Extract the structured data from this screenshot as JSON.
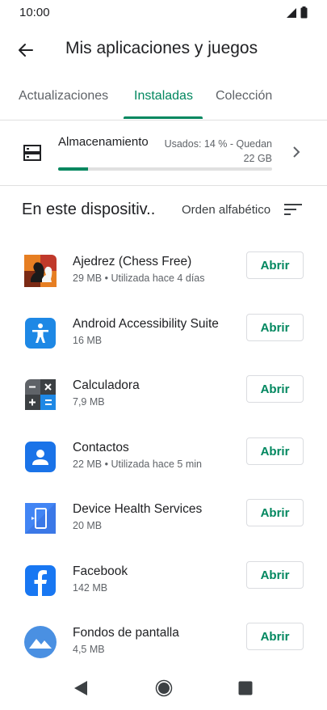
{
  "status_bar": {
    "time": "10:00"
  },
  "header": {
    "title": "Mis aplicaciones y juegos"
  },
  "tabs": [
    {
      "label": "Actualizaciones"
    },
    {
      "label": "Instaladas",
      "active": true
    },
    {
      "label": "Colección"
    }
  ],
  "storage": {
    "title": "Almacenamiento",
    "used_line1": "Usados: 14 % - Quedan",
    "used_line2": "22 GB",
    "used_fraction": 0.14
  },
  "section": {
    "title": "En este dispositiv..",
    "sort_label": "Orden alfabético"
  },
  "apps": [
    {
      "name": "Ajedrez (Chess Free)",
      "meta": "29 MB • Utilizada hace 4 días",
      "button": "Abrir",
      "icon": "chess-icon"
    },
    {
      "name": "Android Accessibility Suite",
      "meta": "16 MB",
      "button": "Abrir",
      "icon": "accessibility-icon"
    },
    {
      "name": "Calculadora",
      "meta": "7,9 MB",
      "button": "Abrir",
      "icon": "calculator-icon"
    },
    {
      "name": "Contactos",
      "meta": "22 MB • Utilizada hace 5 min",
      "button": "Abrir",
      "icon": "contacts-icon"
    },
    {
      "name": "Device Health Services",
      "meta": "20 MB",
      "button": "Abrir",
      "icon": "device-health-icon"
    },
    {
      "name": "Facebook",
      "meta": "142 MB",
      "button": "Abrir",
      "icon": "facebook-icon"
    },
    {
      "name": "Fondos de pantalla",
      "meta": "4,5 MB",
      "button": "Abrir",
      "icon": "wallpapers-icon"
    }
  ],
  "colors": {
    "accent": "#01875f",
    "text": "#202124",
    "secondary": "#5f6368"
  }
}
